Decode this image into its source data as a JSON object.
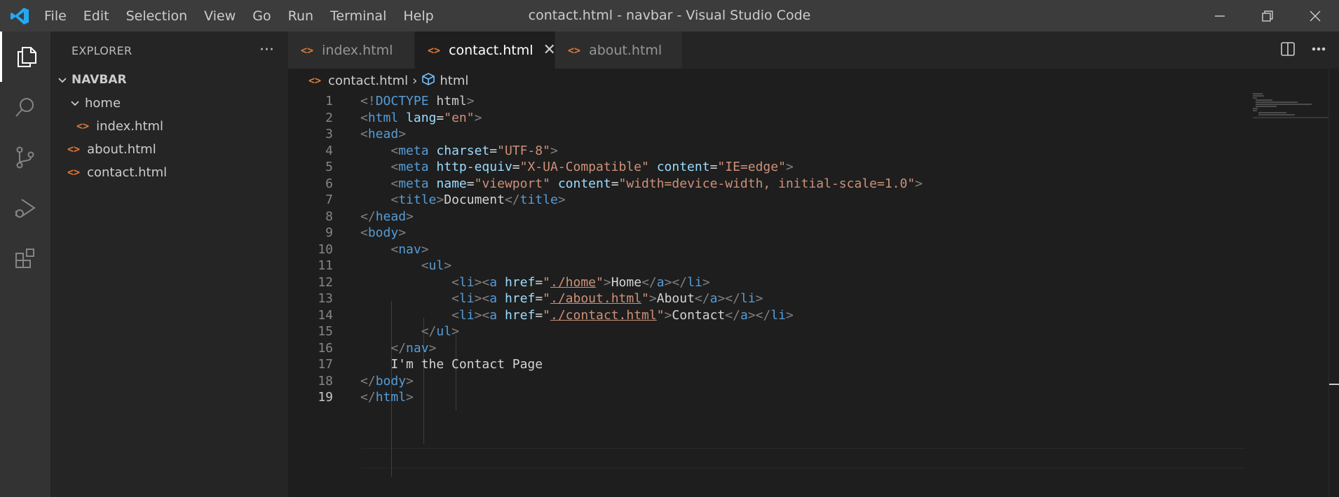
{
  "window": {
    "title": "contact.html - navbar - Visual Studio Code",
    "logo": "vscode-logo",
    "controls": [
      "minimize-icon",
      "restore-icon",
      "close-icon"
    ]
  },
  "menu": [
    "File",
    "Edit",
    "Selection",
    "View",
    "Go",
    "Run",
    "Terminal",
    "Help"
  ],
  "activity_bar": [
    "files-icon",
    "search-icon",
    "source-control-icon",
    "run-debug-icon",
    "extensions-icon"
  ],
  "explorer": {
    "header": "EXPLORER",
    "more": "···",
    "root": "NAVBAR",
    "folder": "home",
    "files": {
      "index": "index.html",
      "about": "about.html",
      "contact": "contact.html"
    }
  },
  "tabs": [
    {
      "label": "index.html",
      "active": false
    },
    {
      "label": "contact.html",
      "active": true
    },
    {
      "label": "about.html",
      "active": false
    }
  ],
  "tab_actions": [
    "split-editor-icon",
    "more-actions-icon"
  ],
  "breadcrumb": {
    "file": "contact.html",
    "symbol": "html"
  },
  "editor": {
    "line_numbers": [
      "1",
      "2",
      "3",
      "4",
      "5",
      "6",
      "7",
      "8",
      "9",
      "10",
      "11",
      "12",
      "13",
      "14",
      "15",
      "16",
      "17",
      "18",
      "19"
    ],
    "current_line": "19",
    "lines": [
      "<!DOCTYPE html>",
      "<html lang=\"en\">",
      "<head>",
      "    <meta charset=\"UTF-8\">",
      "    <meta http-equiv=\"X-UA-Compatible\" content=\"IE=edge\">",
      "    <meta name=\"viewport\" content=\"width=device-width, initial-scale=1.0\">",
      "    <title>Document</title>",
      "</head>",
      "<body>",
      "    <nav>",
      "        <ul>",
      "            <li><a href=\"./home\">Home</a></li>",
      "            <li><a href=\"./about.html\">About</a></li>",
      "            <li><a href=\"./contact.html\">Contact</a></li>",
      "        </ul>",
      "    </nav>",
      "    I'm the Contact Page",
      "</body>",
      "</html>"
    ]
  },
  "colors": {
    "tag": "#569cd6",
    "punctuation": "#808080",
    "attribute": "#9cdcfe",
    "string": "#ce9178",
    "text": "#d4d4d4",
    "file_icon": "#e37933"
  }
}
